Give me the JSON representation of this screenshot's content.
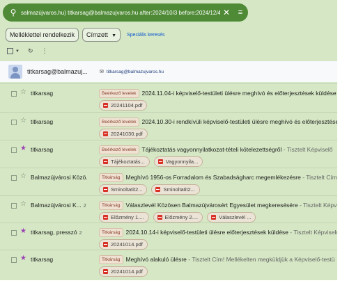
{
  "search": {
    "query": "salmazújvaros.hu) titkarsag@balmazujvaros.hu after:2024/10/3 before:2024/12/4"
  },
  "filters": {
    "chip_attachment": "Melléklettel rendelkezik",
    "chip_to": "Címzett",
    "advanced": "Speciális keresés"
  },
  "contact": {
    "name": "titkarsag@balmazuj...",
    "email": "titkarsag@balmazujvaros.hu"
  },
  "emails": [
    {
      "sender": "titkarsag",
      "count": "",
      "starred": false,
      "label": "Beérkező levelek",
      "subject": "2024.11.04-i képviselő-testületi ülésre meghívó és előterjesztések küldése",
      "snippet": "",
      "attachments": [
        "20241104.pdf"
      ]
    },
    {
      "sender": "titkarsag",
      "count": "",
      "starred": false,
      "label": "Beérkező levelek",
      "subject": "2024.10.30-i rendkívüli képviselő-testületi ülésre meghívó és előterjesztések",
      "snippet": "",
      "attachments": [
        "20241030.pdf"
      ]
    },
    {
      "sender": "titkarsag",
      "count": "",
      "starred": true,
      "label": "Beérkező levelek",
      "subject": "Tájékoztatás vagyonnyilatkozat-tételi kötelezettségről",
      "snippet": " - Tisztelt Képviselő",
      "attachments": [
        "Tájékoztatás...",
        "Vagyonnyila..."
      ]
    },
    {
      "sender": "Balmazújvárosi Közö.",
      "count": "",
      "starred": false,
      "label": "Titkárság",
      "subject": "Meghívó 1956-os Forradalom és Szabadságharc megemlékezésre",
      "snippet": " - Tisztelt Cím!",
      "attachments": [
        "Sminoltatit2...",
        "Sminoltatit2..."
      ]
    },
    {
      "sender": "Balmazújvárosi K...",
      "count": "2",
      "starred": false,
      "label": "Titkárság",
      "subject": "Válaszlevél Közösen Balmazújvárosért Egyesület megkeresésére",
      "snippet": " - Tisztelt Képvi",
      "attachments": [
        "Előzmény 1....",
        "Előzmény 2....",
        "Válaszlevél ..."
      ]
    },
    {
      "sender": "titkarsag, presszó",
      "count": "2",
      "starred": true,
      "label": "Titkárság",
      "subject": "2024.10.14-i képviselő-testületi ülésre előterjesztések küldése",
      "snippet": " - Tisztelt Képviselő",
      "attachments": [
        "20241014.pdf"
      ]
    },
    {
      "sender": "titkarsag",
      "count": "",
      "starred": true,
      "label": "Titkárság",
      "subject": "Meghívó alakuló ülésre",
      "snippet": " - Tisztelt Cím! Mellékelten megküldjük a Képviselő-testü",
      "attachments": [
        "20241014.pdf"
      ]
    }
  ],
  "colors": {
    "background": "#d5e7c4",
    "searchbar": "#4f8a36",
    "star_on": "#9b3fb5",
    "pdf_icon": "#d93025"
  }
}
